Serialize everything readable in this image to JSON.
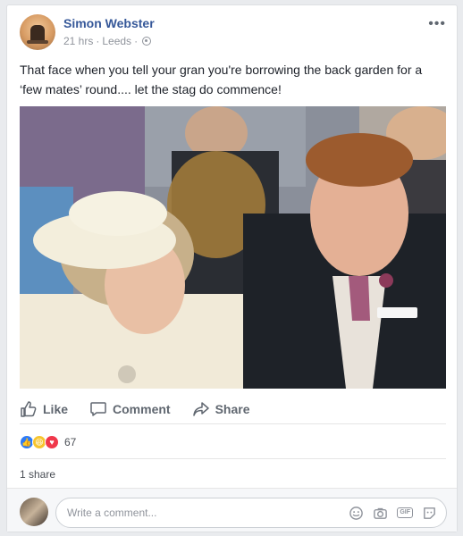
{
  "post": {
    "author": "Simon Webster",
    "time": "21 hrs",
    "location": "Leeds",
    "separator": "·",
    "text": "That face when you tell your gran you're borrowing the back garden for a ‘few mates’ round.... let the stag do commence!",
    "more_icon": "more-options-icon"
  },
  "actions": {
    "like": "Like",
    "comment": "Comment",
    "share": "Share"
  },
  "reactions": {
    "count": "67",
    "types": [
      "like",
      "haha",
      "love"
    ]
  },
  "shares": "1 share",
  "comment_box": {
    "placeholder": "Write a comment..."
  },
  "colors": {
    "link_blue": "#365899",
    "meta_gray": "#90949c",
    "background": "#e9ebee"
  }
}
